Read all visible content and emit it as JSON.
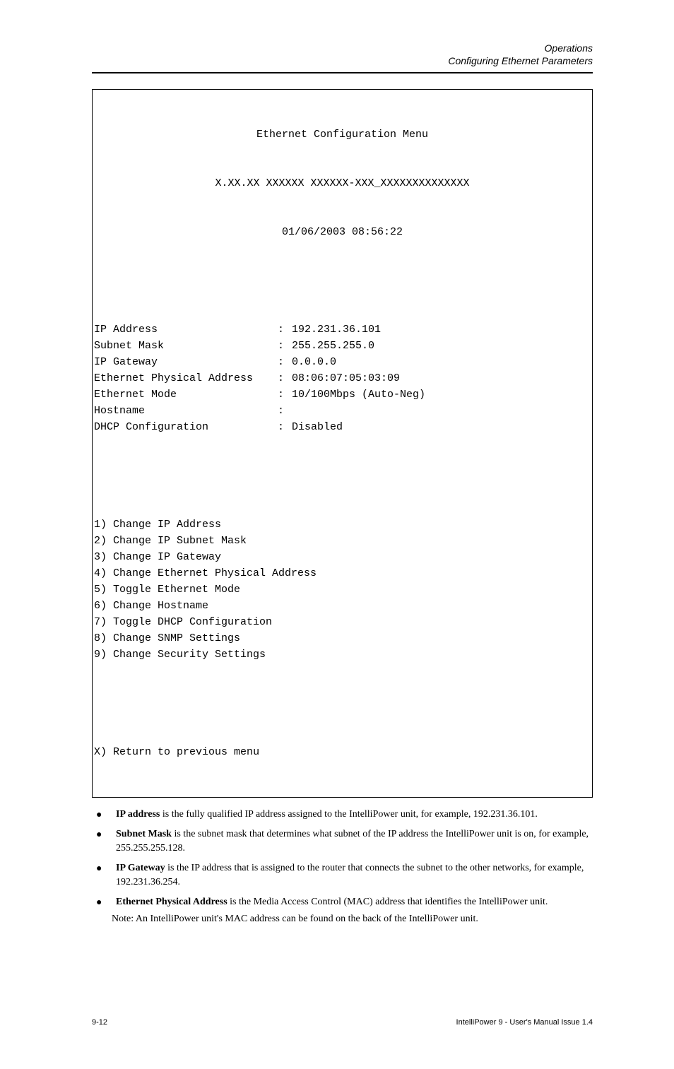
{
  "header": {
    "line1": "Operations",
    "line2": "Configuring Ethernet Parameters"
  },
  "terminal": {
    "title": "Ethernet Configuration Menu",
    "build": "X.XX.XX XXXXXX XXXXXX-XXX_XXXXXXXXXXXXXX",
    "timestamp": "01/06/2003 08:56:22",
    "status": [
      {
        "label": "IP Address",
        "value": "192.231.36.101"
      },
      {
        "label": "Subnet Mask",
        "value": "255.255.255.0"
      },
      {
        "label": "IP Gateway",
        "value": "0.0.0.0"
      },
      {
        "label": "Ethernet Physical Address",
        "value": "08:06:07:05:03:09"
      },
      {
        "label": "Ethernet Mode",
        "value": "10/100Mbps (Auto-Neg)"
      },
      {
        "label": "Hostname",
        "value": ""
      },
      {
        "label": "DHCP Configuration",
        "value": "Disabled"
      }
    ],
    "menu": [
      {
        "key": "1",
        "label": "Change IP Address"
      },
      {
        "key": "2",
        "label": "Change IP Subnet Mask"
      },
      {
        "key": "3",
        "label": "Change IP Gateway"
      },
      {
        "key": "4",
        "label": "Change Ethernet Physical Address"
      },
      {
        "key": "5",
        "label": "Toggle Ethernet Mode"
      },
      {
        "key": "6",
        "label": "Change Hostname"
      },
      {
        "key": "7",
        "label": "Toggle DHCP Configuration"
      },
      {
        "key": "8",
        "label": "Change SNMP Settings"
      },
      {
        "key": "9",
        "label": "Change Security Settings"
      }
    ],
    "exit": {
      "key": "X",
      "label": "Return to previous menu"
    }
  },
  "bullets": [
    {
      "strong": "IP address",
      "text": " is the fully qualified IP address assigned to the IntelliPower unit, for example, 192.231.36.101."
    },
    {
      "strong": "Subnet Mask",
      "text": " is the subnet mask that determines what subnet of the IP address the IntelliPower unit is on, for example, 255.255.255.128."
    },
    {
      "strong": "IP Gateway",
      "text": " is the IP address that is assigned to the router that connects the subnet to the other networks, for example, 192.231.36.254."
    },
    {
      "strong": "Ethernet Physical Address",
      "text": " is the Media Access Control (MAC) address that identifies the IntelliPower unit."
    }
  ],
  "note": "Note: An IntelliPower unit's MAC address can be found on the back of the IntelliPower unit.",
  "footer": {
    "left": "9-12",
    "right": "IntelliPower 9 - User's Manual  Issue 1.4"
  }
}
